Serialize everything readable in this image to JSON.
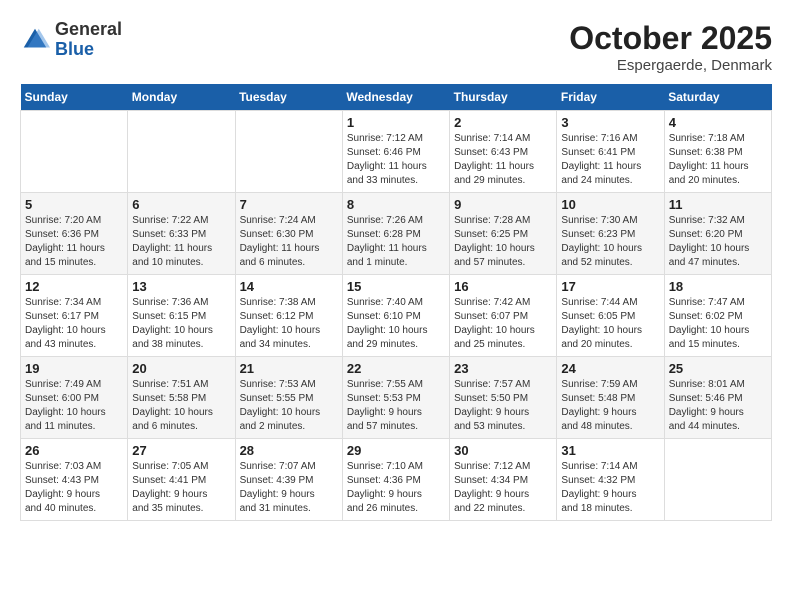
{
  "logo": {
    "general": "General",
    "blue": "Blue"
  },
  "title": "October 2025",
  "location": "Espergaerde, Denmark",
  "weekdays": [
    "Sunday",
    "Monday",
    "Tuesday",
    "Wednesday",
    "Thursday",
    "Friday",
    "Saturday"
  ],
  "weeks": [
    [
      {
        "day": "",
        "info": ""
      },
      {
        "day": "",
        "info": ""
      },
      {
        "day": "",
        "info": ""
      },
      {
        "day": "1",
        "info": "Sunrise: 7:12 AM\nSunset: 6:46 PM\nDaylight: 11 hours\nand 33 minutes."
      },
      {
        "day": "2",
        "info": "Sunrise: 7:14 AM\nSunset: 6:43 PM\nDaylight: 11 hours\nand 29 minutes."
      },
      {
        "day": "3",
        "info": "Sunrise: 7:16 AM\nSunset: 6:41 PM\nDaylight: 11 hours\nand 24 minutes."
      },
      {
        "day": "4",
        "info": "Sunrise: 7:18 AM\nSunset: 6:38 PM\nDaylight: 11 hours\nand 20 minutes."
      }
    ],
    [
      {
        "day": "5",
        "info": "Sunrise: 7:20 AM\nSunset: 6:36 PM\nDaylight: 11 hours\nand 15 minutes."
      },
      {
        "day": "6",
        "info": "Sunrise: 7:22 AM\nSunset: 6:33 PM\nDaylight: 11 hours\nand 10 minutes."
      },
      {
        "day": "7",
        "info": "Sunrise: 7:24 AM\nSunset: 6:30 PM\nDaylight: 11 hours\nand 6 minutes."
      },
      {
        "day": "8",
        "info": "Sunrise: 7:26 AM\nSunset: 6:28 PM\nDaylight: 11 hours\nand 1 minute."
      },
      {
        "day": "9",
        "info": "Sunrise: 7:28 AM\nSunset: 6:25 PM\nDaylight: 10 hours\nand 57 minutes."
      },
      {
        "day": "10",
        "info": "Sunrise: 7:30 AM\nSunset: 6:23 PM\nDaylight: 10 hours\nand 52 minutes."
      },
      {
        "day": "11",
        "info": "Sunrise: 7:32 AM\nSunset: 6:20 PM\nDaylight: 10 hours\nand 47 minutes."
      }
    ],
    [
      {
        "day": "12",
        "info": "Sunrise: 7:34 AM\nSunset: 6:17 PM\nDaylight: 10 hours\nand 43 minutes."
      },
      {
        "day": "13",
        "info": "Sunrise: 7:36 AM\nSunset: 6:15 PM\nDaylight: 10 hours\nand 38 minutes."
      },
      {
        "day": "14",
        "info": "Sunrise: 7:38 AM\nSunset: 6:12 PM\nDaylight: 10 hours\nand 34 minutes."
      },
      {
        "day": "15",
        "info": "Sunrise: 7:40 AM\nSunset: 6:10 PM\nDaylight: 10 hours\nand 29 minutes."
      },
      {
        "day": "16",
        "info": "Sunrise: 7:42 AM\nSunset: 6:07 PM\nDaylight: 10 hours\nand 25 minutes."
      },
      {
        "day": "17",
        "info": "Sunrise: 7:44 AM\nSunset: 6:05 PM\nDaylight: 10 hours\nand 20 minutes."
      },
      {
        "day": "18",
        "info": "Sunrise: 7:47 AM\nSunset: 6:02 PM\nDaylight: 10 hours\nand 15 minutes."
      }
    ],
    [
      {
        "day": "19",
        "info": "Sunrise: 7:49 AM\nSunset: 6:00 PM\nDaylight: 10 hours\nand 11 minutes."
      },
      {
        "day": "20",
        "info": "Sunrise: 7:51 AM\nSunset: 5:58 PM\nDaylight: 10 hours\nand 6 minutes."
      },
      {
        "day": "21",
        "info": "Sunrise: 7:53 AM\nSunset: 5:55 PM\nDaylight: 10 hours\nand 2 minutes."
      },
      {
        "day": "22",
        "info": "Sunrise: 7:55 AM\nSunset: 5:53 PM\nDaylight: 9 hours\nand 57 minutes."
      },
      {
        "day": "23",
        "info": "Sunrise: 7:57 AM\nSunset: 5:50 PM\nDaylight: 9 hours\nand 53 minutes."
      },
      {
        "day": "24",
        "info": "Sunrise: 7:59 AM\nSunset: 5:48 PM\nDaylight: 9 hours\nand 48 minutes."
      },
      {
        "day": "25",
        "info": "Sunrise: 8:01 AM\nSunset: 5:46 PM\nDaylight: 9 hours\nand 44 minutes."
      }
    ],
    [
      {
        "day": "26",
        "info": "Sunrise: 7:03 AM\nSunset: 4:43 PM\nDaylight: 9 hours\nand 40 minutes."
      },
      {
        "day": "27",
        "info": "Sunrise: 7:05 AM\nSunset: 4:41 PM\nDaylight: 9 hours\nand 35 minutes."
      },
      {
        "day": "28",
        "info": "Sunrise: 7:07 AM\nSunset: 4:39 PM\nDaylight: 9 hours\nand 31 minutes."
      },
      {
        "day": "29",
        "info": "Sunrise: 7:10 AM\nSunset: 4:36 PM\nDaylight: 9 hours\nand 26 minutes."
      },
      {
        "day": "30",
        "info": "Sunrise: 7:12 AM\nSunset: 4:34 PM\nDaylight: 9 hours\nand 22 minutes."
      },
      {
        "day": "31",
        "info": "Sunrise: 7:14 AM\nSunset: 4:32 PM\nDaylight: 9 hours\nand 18 minutes."
      },
      {
        "day": "",
        "info": ""
      }
    ]
  ]
}
